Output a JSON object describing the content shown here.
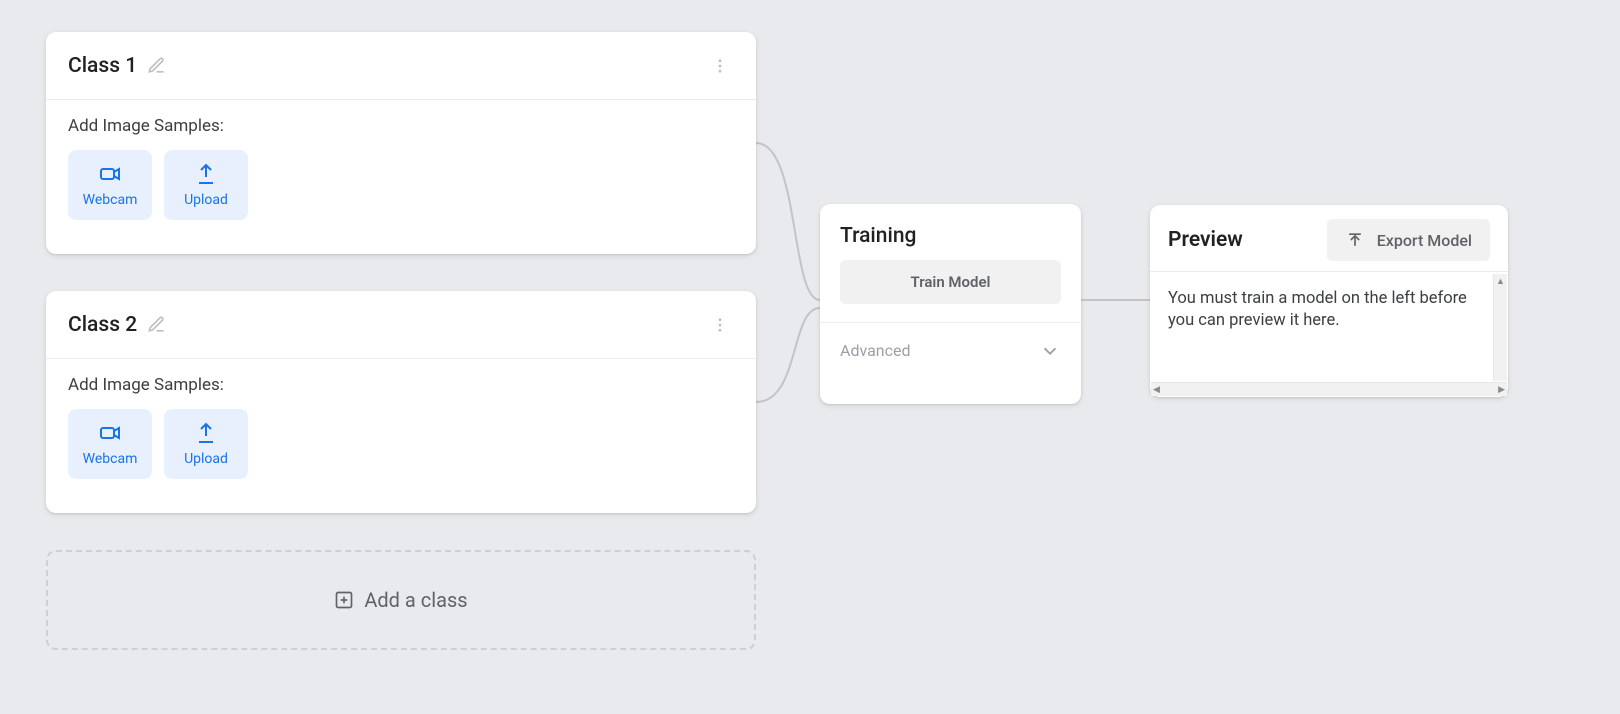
{
  "classes": [
    {
      "name": "Class 1",
      "samples_label": "Add Image Samples:",
      "webcam_label": "Webcam",
      "upload_label": "Upload"
    },
    {
      "name": "Class 2",
      "samples_label": "Add Image Samples:",
      "webcam_label": "Webcam",
      "upload_label": "Upload"
    }
  ],
  "add_class_label": "Add a class",
  "training": {
    "title": "Training",
    "train_button": "Train Model",
    "advanced_label": "Advanced"
  },
  "preview": {
    "title": "Preview",
    "export_button": "Export Model",
    "message": "You must train a model on the left before you can preview it here."
  },
  "colors": {
    "background": "#e9eaed",
    "card": "#ffffff",
    "primary": "#1a73e8",
    "primary_bg": "#e8f0fe",
    "muted": "#5f6368",
    "disabled_bg": "#f1f1f2",
    "border": "#ececec"
  }
}
